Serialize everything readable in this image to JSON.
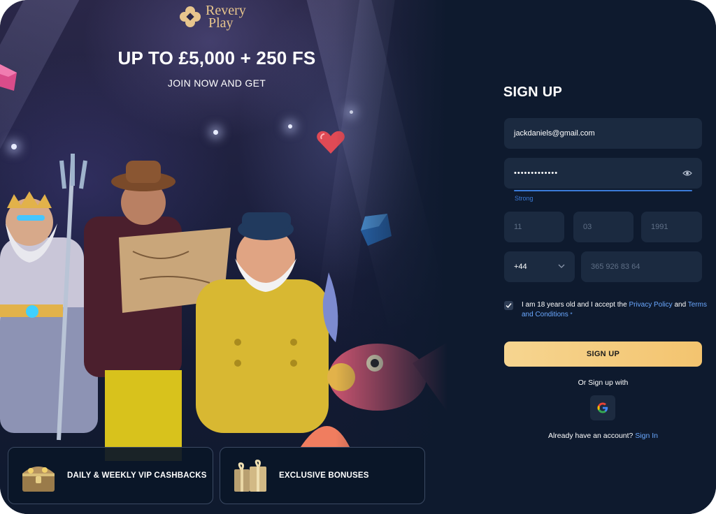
{
  "brand": {
    "logo_line1": "Revery",
    "logo_line2": "Play"
  },
  "promo": {
    "title": "UP TO £5,000 + 250 FS",
    "subtitle": "JOIN NOW AND GET"
  },
  "features": [
    {
      "label": "DAILY & WEEKLY VIP CASHBACKS",
      "icon": "treasure-chest-icon"
    },
    {
      "label": "EXCLUSIVE BONUSES",
      "icon": "gift-boxes-icon"
    }
  ],
  "form": {
    "title": "SIGN UP",
    "email": "jackdaniels@gmail.com",
    "password_masked": "•••••••••••••",
    "password_strength": "Strong",
    "dob": {
      "day": "11",
      "month": "03",
      "year": "1991"
    },
    "phone_code": "+44",
    "phone_placeholder": "365 926 83 64",
    "consent_prefix": "I am 18 years old and I accept the ",
    "privacy_link": "Privacy Policy",
    "consent_and": " and ",
    "terms_link": "Terms and Conditions",
    "required_mark": "*",
    "submit_label": "SIGN UP",
    "or_text": "Or Sign up with",
    "already_text": "Already have an account? ",
    "signin_link": "Sign In"
  },
  "colors": {
    "accent_gold": "#f3c46f",
    "link_blue": "#6aa8ff",
    "panel_bg": "#0e1a2e",
    "field_bg": "#1b2a40"
  }
}
